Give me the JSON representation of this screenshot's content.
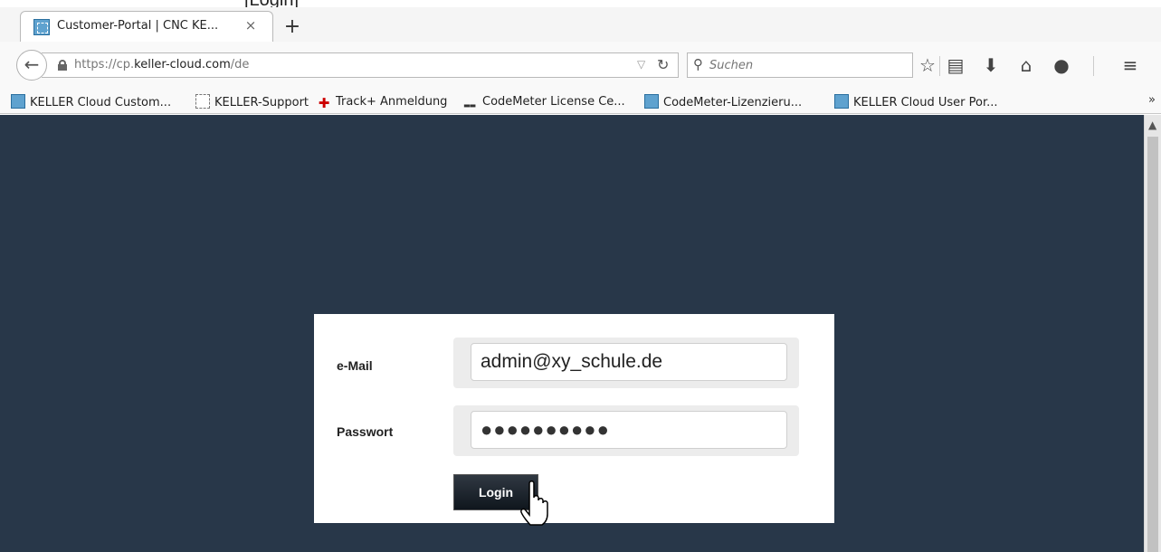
{
  "header_fragment": "[Login]",
  "tab": {
    "title": "Customer-Portal | CNC KE...",
    "close": "×",
    "new_tab": "+"
  },
  "nav": {
    "url_prefix": "https://cp.",
    "url_domain": "keller-cloud.com",
    "url_path": "/de",
    "search_placeholder": "Suchen"
  },
  "bookmarks": [
    {
      "label": "KELLER Cloud Custom...",
      "icon": "cnc-icon"
    },
    {
      "label": "KELLER-Support",
      "icon": "blank-page-icon"
    },
    {
      "label": "Track+ Anmeldung",
      "icon": "track-plus-icon"
    },
    {
      "label": "CodeMeter License Ce...",
      "icon": "wibu-icon"
    },
    {
      "label": "CodeMeter-Lizenzieru...",
      "icon": "cnc-icon"
    },
    {
      "label": "KELLER Cloud User Por...",
      "icon": "cnc-icon"
    }
  ],
  "bookmarks_more": "»",
  "login": {
    "email_label": "e-Mail",
    "email_value": "admin@xy_schule.de",
    "password_label": "Passwort",
    "password_value": "●●●●●●●●●●",
    "login_button": "Login"
  },
  "colors": {
    "page_background": "#283749",
    "button_dark": "#1a222b"
  }
}
